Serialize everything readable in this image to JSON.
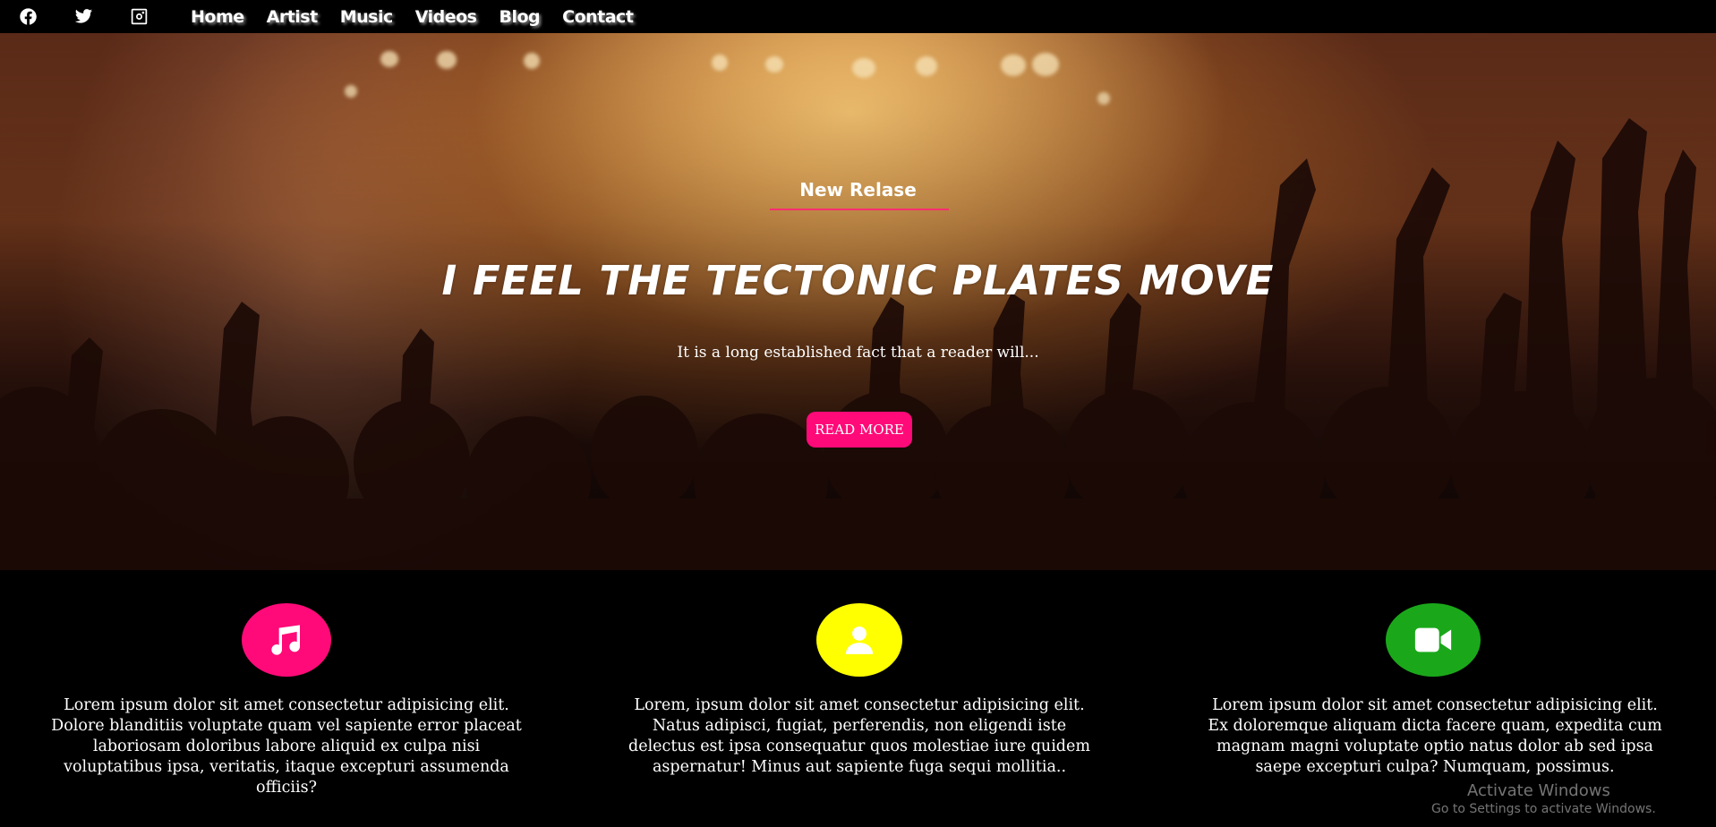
{
  "navbar": {
    "social": [
      {
        "name": "facebook-icon"
      },
      {
        "name": "twitter-icon"
      },
      {
        "name": "instagram-icon"
      }
    ],
    "links": [
      "Home",
      "Artist",
      "Music",
      "Videos",
      "Blog",
      "Contact"
    ]
  },
  "hero": {
    "eyebrow": "New Relase",
    "title": "I FEEL THE TECTONIC PLATES MOVE",
    "subtitle": "It is a long established fact that a reader will...",
    "button": "READ MORE",
    "accent_color": "#ff0a78"
  },
  "features": [
    {
      "icon": "music-note-icon",
      "color": "#ff0a78",
      "text": "Lorem ipsum dolor sit amet consectetur adipisicing elit. Dolore blanditiis voluptate quam vel sapiente error placeat laboriosam doloribus labore aliquid ex culpa nisi voluptatibus ipsa, veritatis, itaque excepturi assumenda officiis?"
    },
    {
      "icon": "user-icon",
      "color": "#ffff00",
      "text": "Lorem, ipsum dolor sit amet consectetur adipisicing elit. Natus adipisci, fugiat, perferendis, non eligendi iste delectus est ipsa consequatur quos molestiae iure quidem aspernatur! Minus aut sapiente fuga sequi mollitia.."
    },
    {
      "icon": "video-camera-icon",
      "color": "#1aa81a",
      "text": "Lorem ipsum dolor sit amet consectetur adipisicing elit. Ex doloremque aliquam dicta facere quam, expedita cum magnam magni voluptate optio natus dolor ab sed ipsa saepe excepturi culpa? Numquam, possimus."
    }
  ],
  "watermark": {
    "line1": "Activate Windows",
    "line2": "Go to Settings to activate Windows."
  }
}
